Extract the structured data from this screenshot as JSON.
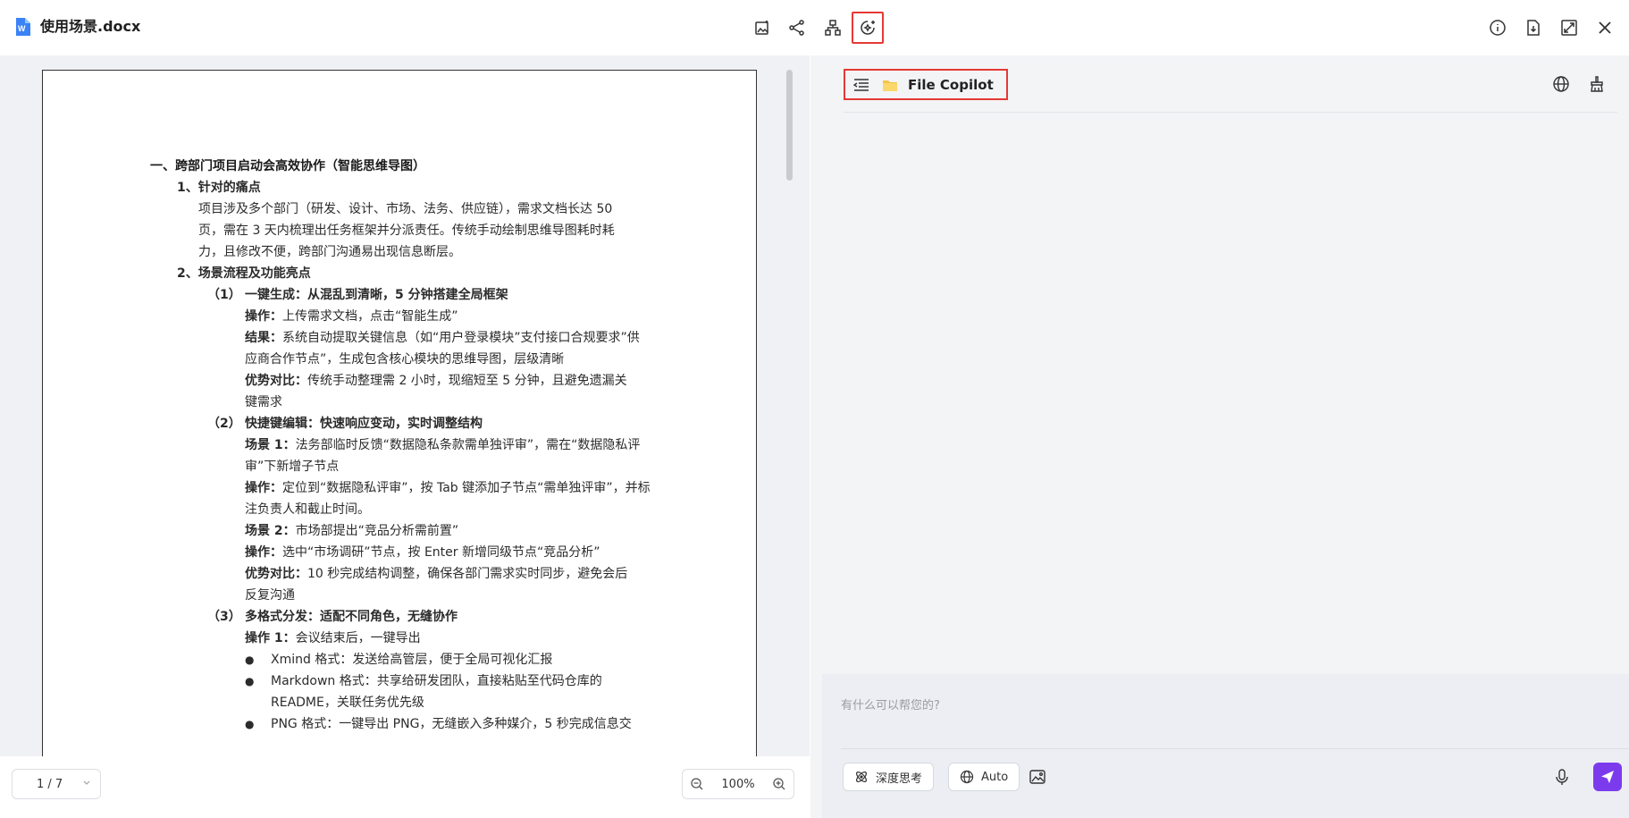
{
  "header": {
    "doc_title": "使用场景.docx",
    "tools": [
      "image-sparkle-icon",
      "share-node-icon",
      "mindmap-icon",
      "ai-sparkle-icon"
    ],
    "right_tools": [
      "info-icon",
      "download-icon",
      "expand-icon",
      "close-icon"
    ]
  },
  "document": {
    "heading1": "一、跨部门项目启动会高效协作（智能思维导图）",
    "sec1_title": "1、针对的痛点",
    "sec1_body": [
      "项目涉及多个部门（研发、设计、市场、法务、供应链），需求文档长达 50",
      "页，需在 3 天内梳理出任务框架并分派责任。传统手动绘制思维导图耗时耗",
      "力，且修改不便，跨部门沟通易出现信息断层。"
    ],
    "sec2_title": "2、场景流程及功能亮点",
    "item1": {
      "num": "（1）",
      "title": "一键生成：从混乱到清晰，5 分钟搭建全局框架",
      "op_label": "操作：",
      "op_text": "上传需求文档，点击“智能生成”",
      "res_label": "结果：",
      "res_text": "系统自动提取关键信息（如“用户登录模块”支付接口合规要求”供",
      "res_cont": "应商合作节点”，生成包含核心模块的思维导图，层级清晰",
      "adv_label": "优势对比：",
      "adv_text": "传统手动整理需 2 小时，现缩短至 5 分钟，且避免遗漏关",
      "adv_cont": "键需求"
    },
    "item2": {
      "num": "（2）",
      "title": "快捷键编辑：快速响应变动，实时调整结构",
      "s1_label": "场景 1：",
      "s1_text": "法务部临时反馈“数据隐私条款需单独评审”，需在“数据隐私评",
      "s1_cont": "审”下新增子节点",
      "op1_label": "操作：",
      "op1_text": "定位到“数据隐私评审”，按 Tab 键添加子节点“需单独评审”，并标",
      "op1_cont": "注负责人和截止时间。",
      "s2_label": "场景 2：",
      "s2_text": "市场部提出“竞品分析需前置”",
      "op2_label": "操作：",
      "op2_text": "选中“市场调研”节点，按 Enter 新增同级节点“竞品分析”",
      "adv_label": "优势对比：",
      "adv_text": "10 秒完成结构调整，确保各部门需求实时同步，避免会后",
      "adv_cont": "反复沟通"
    },
    "item3": {
      "num": "（3）",
      "title": "多格式分发：适配不同角色，无缝协作",
      "op_label": "操作 1：",
      "op_text": "会议结束后，一键导出",
      "bullets": [
        {
          "text": "Xmind 格式：发送给高管层，便于全局可视化汇报",
          "cont": ""
        },
        {
          "text": "Markdown 格式：共享给研发团队，直接粘贴至代码仓库的",
          "cont": "README，关联任务优先级"
        },
        {
          "text": "PNG 格式：一键导出 PNG，无缝嵌入多种媒介，5 秒完成信息交",
          "cont": ""
        }
      ]
    }
  },
  "footer": {
    "page_indicator": "1 / 7",
    "zoom": "100%"
  },
  "copilot": {
    "title": "File Copilot",
    "placeholder": "有什么可以帮您的?",
    "chip_deep": "深度思考",
    "chip_auto": "Auto"
  },
  "colors": {
    "accent": "#7c3aed",
    "highlight_box": "#e53935",
    "doc_icon": "#3b82f6"
  }
}
